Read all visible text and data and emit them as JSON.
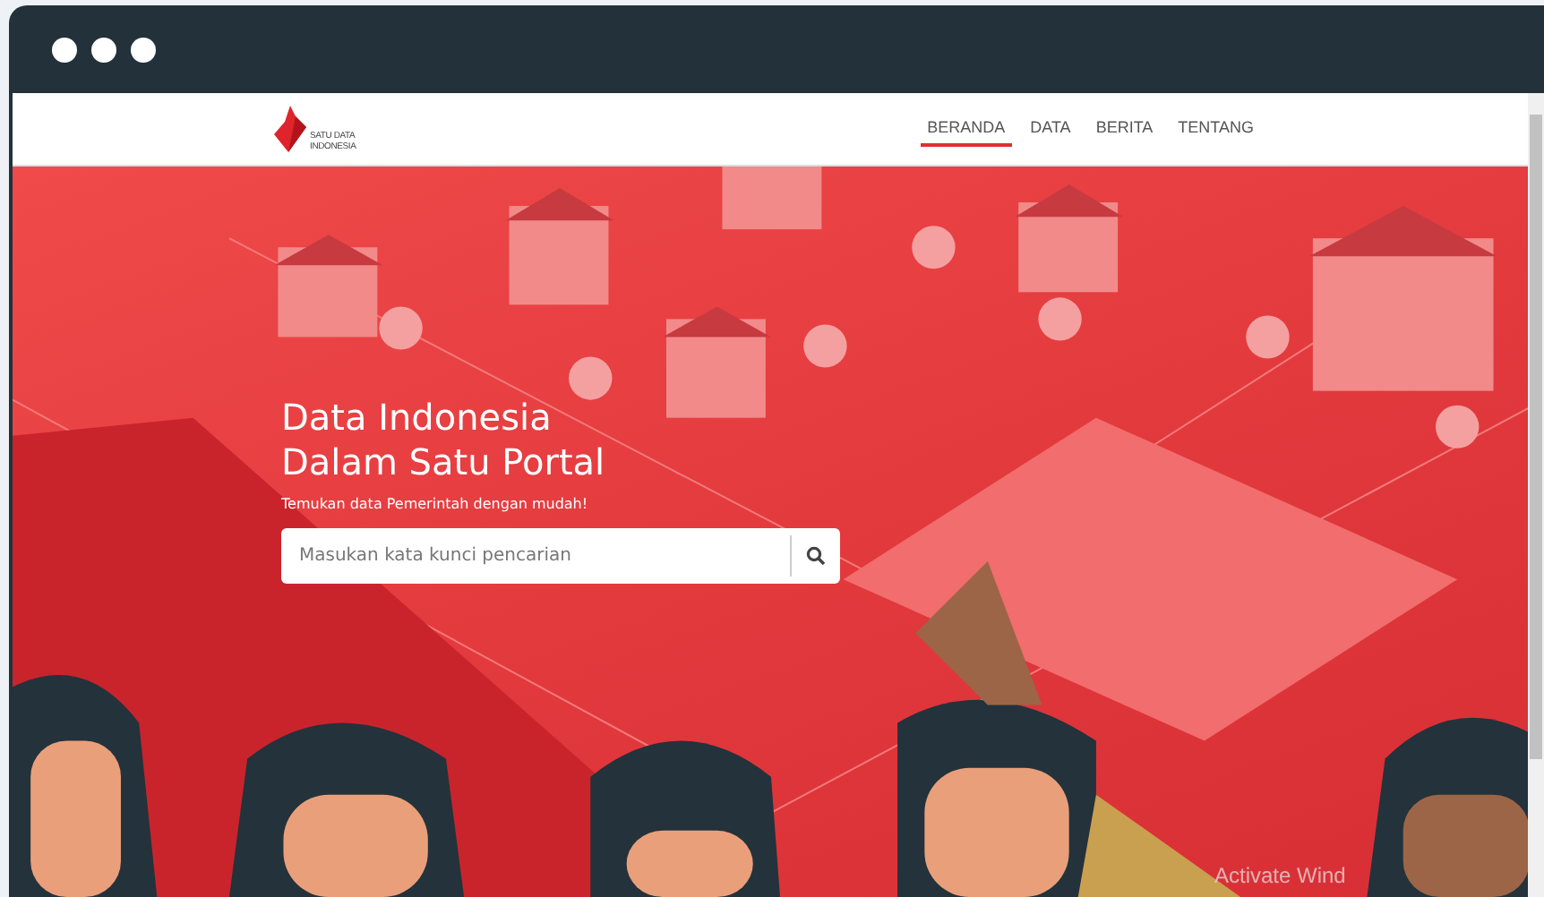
{
  "logo": {
    "lines": [
      "SATU DATA",
      "INDONESIA"
    ]
  },
  "nav": {
    "items": [
      {
        "label": "BERANDA",
        "selected": true
      },
      {
        "label": "DATA",
        "selected": false
      },
      {
        "label": "BERITA",
        "selected": false
      },
      {
        "label": "TENTANG",
        "selected": false
      }
    ]
  },
  "hero": {
    "title_lines": [
      "Data Indonesia",
      "Dalam Satu Portal"
    ],
    "subtitle": "Temukan data Pemerintah dengan mudah!",
    "search": {
      "placeholder": "Masukan kata kunci pencarian"
    }
  },
  "os_overlay": {
    "text": "Activate Wind"
  }
}
